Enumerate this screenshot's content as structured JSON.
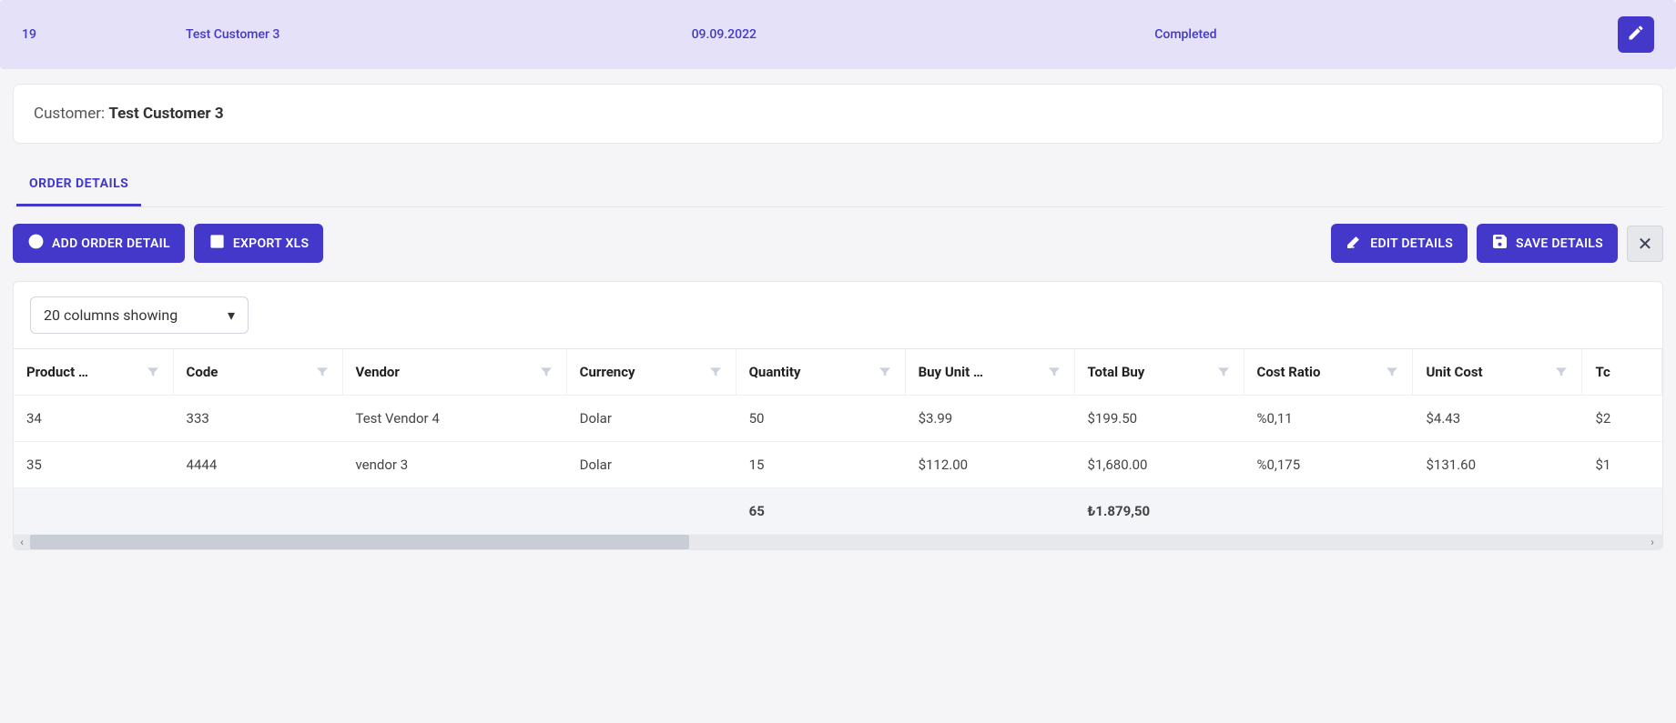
{
  "summary": {
    "id": "19",
    "customer": "Test Customer 3",
    "date": "09.09.2022",
    "status": "Completed"
  },
  "customerCard": {
    "label": "Customer: ",
    "name": "Test Customer 3"
  },
  "tabs": {
    "orderDetails": "ORDER DETAILS"
  },
  "actions": {
    "addOrderDetail": "ADD ORDER DETAIL",
    "exportXls": "EXPORT XLS",
    "editDetails": "EDIT DETAILS",
    "saveDetails": "SAVE DETAILS"
  },
  "columnsSelector": {
    "label": "20 columns showing"
  },
  "columns": {
    "productId": "Product …",
    "code": "Code",
    "vendor": "Vendor",
    "currency": "Currency",
    "quantity": "Quantity",
    "buyUnitPrice": "Buy Unit …",
    "totalBuy": "Total Buy",
    "costRatio": "Cost Ratio",
    "unitCost": "Unit Cost",
    "totalCostTrunc": "Tc"
  },
  "rows": [
    {
      "productId": "34",
      "code": "333",
      "vendor": "Test Vendor 4",
      "currency": "Dolar",
      "quantity": "50",
      "buyUnitPrice": "$3.99",
      "totalBuy": "$199.50",
      "costRatio": "%0,11",
      "unitCost": "$4.43",
      "totalCostTrunc": "$2"
    },
    {
      "productId": "35",
      "code": "4444",
      "vendor": "vendor 3",
      "currency": "Dolar",
      "quantity": "15",
      "buyUnitPrice": "$112.00",
      "totalBuy": "$1,680.00",
      "costRatio": "%0,175",
      "unitCost": "$131.60",
      "totalCostTrunc": "$1"
    }
  ],
  "footer": {
    "quantitySum": "65",
    "totalBuySum": "₺1.879,50"
  }
}
